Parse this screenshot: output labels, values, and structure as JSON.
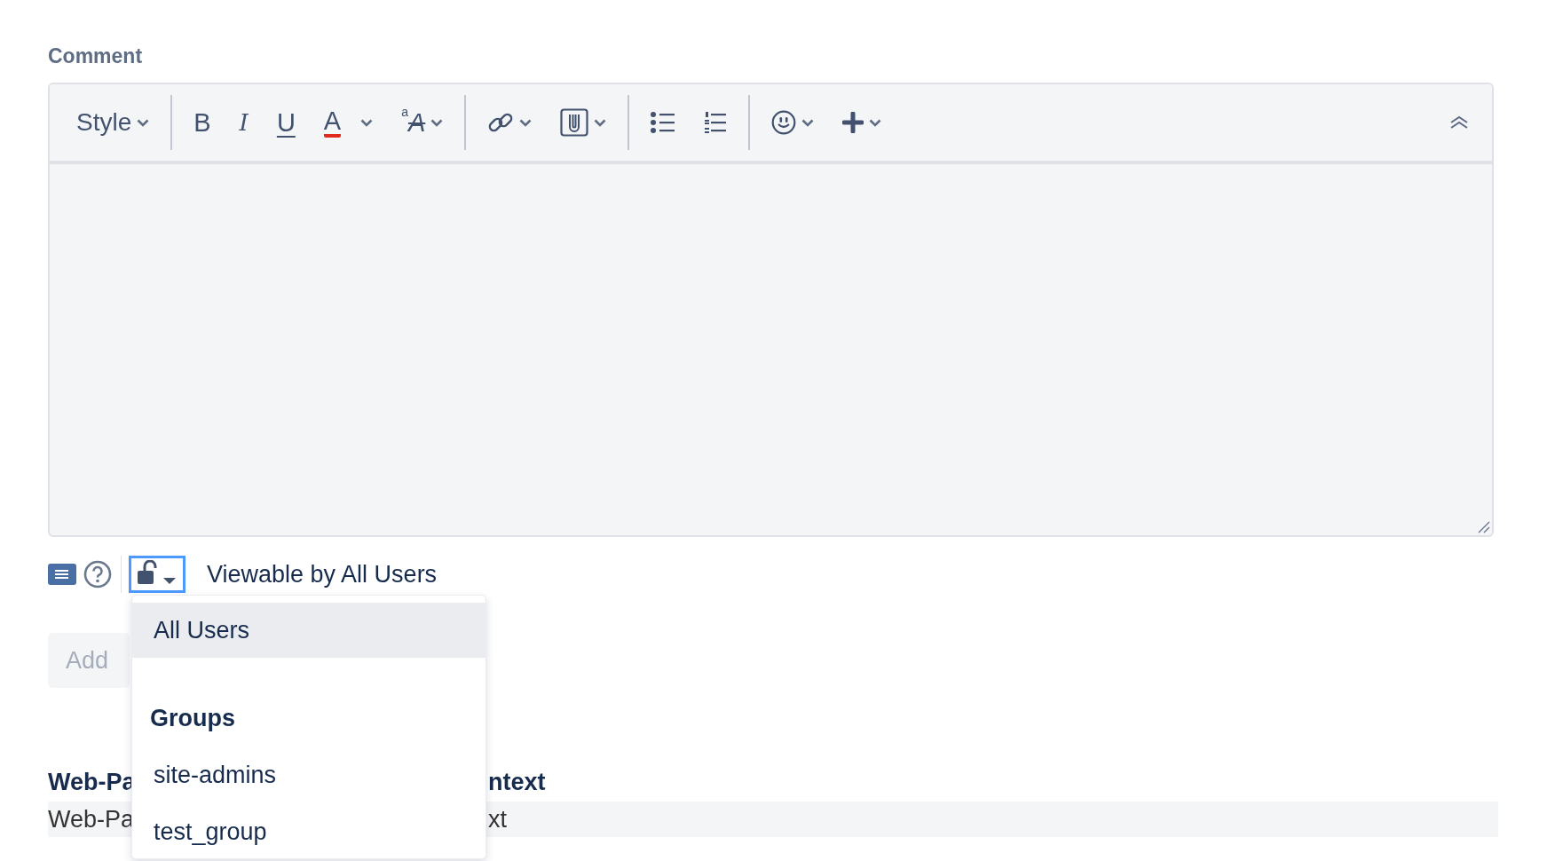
{
  "label": "Comment",
  "toolbar": {
    "groups": [
      [
        {
          "kind": "style",
          "label": "Style",
          "dropdown": true
        }
      ],
      [
        {
          "kind": "bold",
          "label": "B",
          "dropdown": false
        },
        {
          "kind": "italic",
          "label": "I",
          "dropdown": false
        },
        {
          "kind": "underline",
          "label": "U",
          "dropdown": false
        },
        {
          "kind": "color",
          "label": "A",
          "dropdown": true
        },
        {
          "kind": "format",
          "label": "A",
          "small": "a",
          "dropdown": true
        }
      ],
      [
        {
          "kind": "link",
          "dropdown": true
        },
        {
          "kind": "attach",
          "dropdown": true
        }
      ],
      [
        {
          "kind": "bullets",
          "dropdown": false
        },
        {
          "kind": "numbers",
          "dropdown": false
        }
      ],
      [
        {
          "kind": "emoji",
          "dropdown": true
        },
        {
          "kind": "plus",
          "dropdown": true
        }
      ]
    ]
  },
  "visibility": {
    "label": "Viewable by All Users",
    "locked": false
  },
  "menu": {
    "items": [
      {
        "label": "All Users",
        "selected": true
      }
    ],
    "section": "Groups",
    "groups": [
      {
        "label": "site-admins",
        "selected": false
      },
      {
        "label": "test_group",
        "selected": false
      }
    ]
  },
  "add_button": {
    "label": "Add",
    "disabled": true
  },
  "table": {
    "heading": [
      "Web-Pa",
      "ntext"
    ],
    "row": [
      "Web-Pa",
      "xt"
    ]
  }
}
